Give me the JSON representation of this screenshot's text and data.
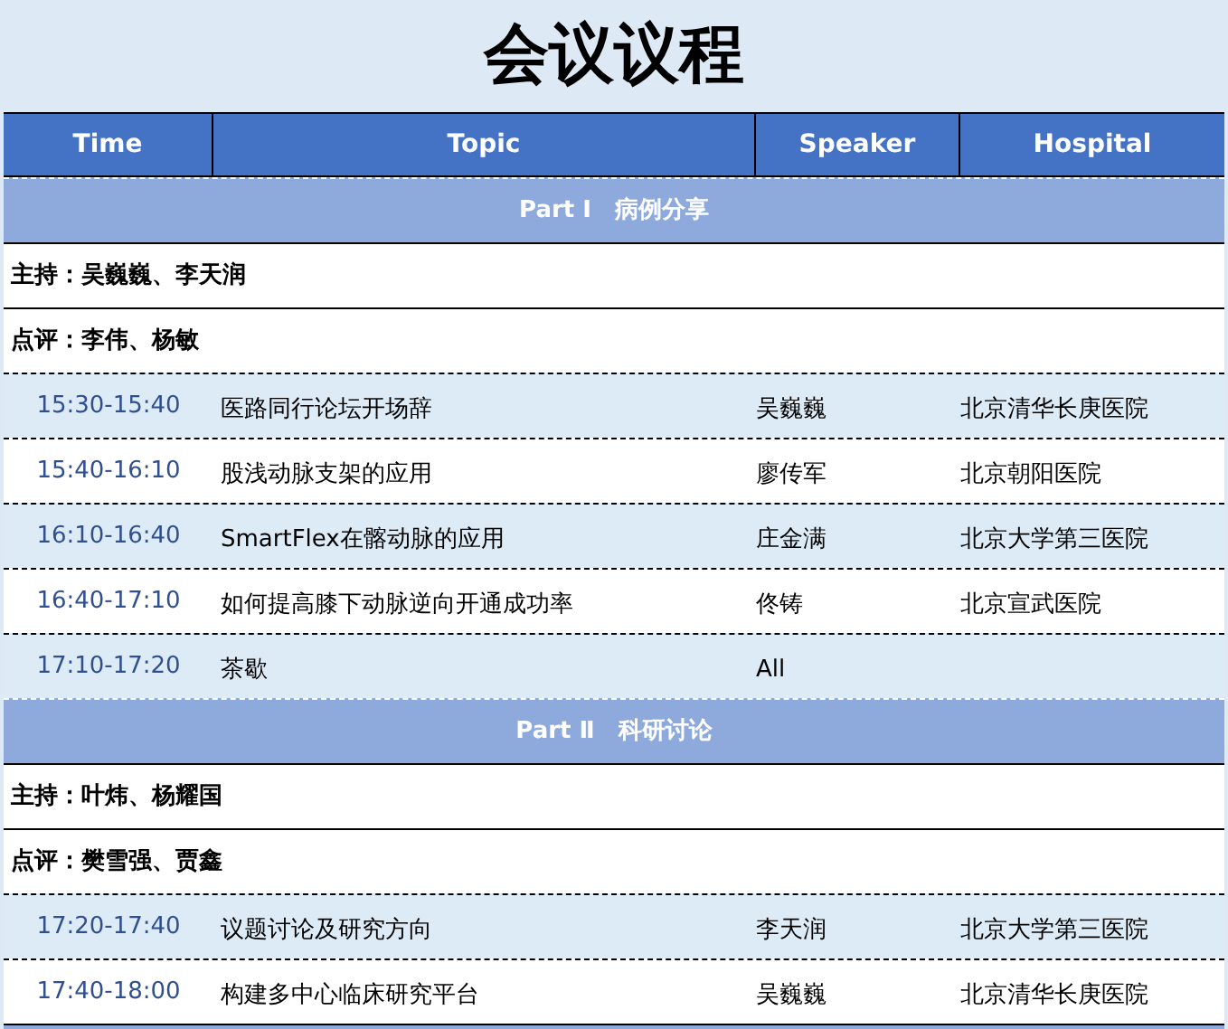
{
  "title": "会议议程",
  "columns": [
    "Time",
    "Topic",
    "Speaker",
    "Hospital"
  ],
  "parts": [
    {
      "heading": "Part Ⅰ　病例分享",
      "notes": [
        "主持：吴巍巍、李天润",
        "点评：李伟、杨敏"
      ],
      "sessions": [
        {
          "time": "15:30-15:40",
          "topic": "医路同行论坛开场辞",
          "speaker": "吴巍巍",
          "hospital": "北京清华长庚医院"
        },
        {
          "time": "15:40-16:10",
          "topic": "股浅动脉支架的应用",
          "speaker": "廖传军",
          "hospital": "北京朝阳医院"
        },
        {
          "time": "16:10-16:40",
          "topic": "SmartFlex在髂动脉的应用",
          "speaker": "庄金满",
          "hospital": "北京大学第三医院"
        },
        {
          "time": "16:40-17:10",
          "topic": "如何提高膝下动脉逆向开通成功率",
          "speaker": "佟铸",
          "hospital": "北京宣武医院"
        },
        {
          "time": "17:10-17:20",
          "topic": "茶歇",
          "speaker": "All"
        }
      ]
    },
    {
      "heading": "Part Ⅱ　科研讨论",
      "notes": [
        "主持：叶炜、杨耀国",
        "点评：樊雪强、贾鑫"
      ],
      "sessions": [
        {
          "time": "17:20-17:40",
          "topic": "议题讨论及研究方向",
          "speaker": "李天润",
          "hospital": "北京大学第三医院"
        },
        {
          "time": "17:40-18:00",
          "topic": "构建多中心临床研究平台",
          "speaker": "吴巍巍",
          "hospital": "北京清华长庚医院"
        }
      ]
    }
  ]
}
